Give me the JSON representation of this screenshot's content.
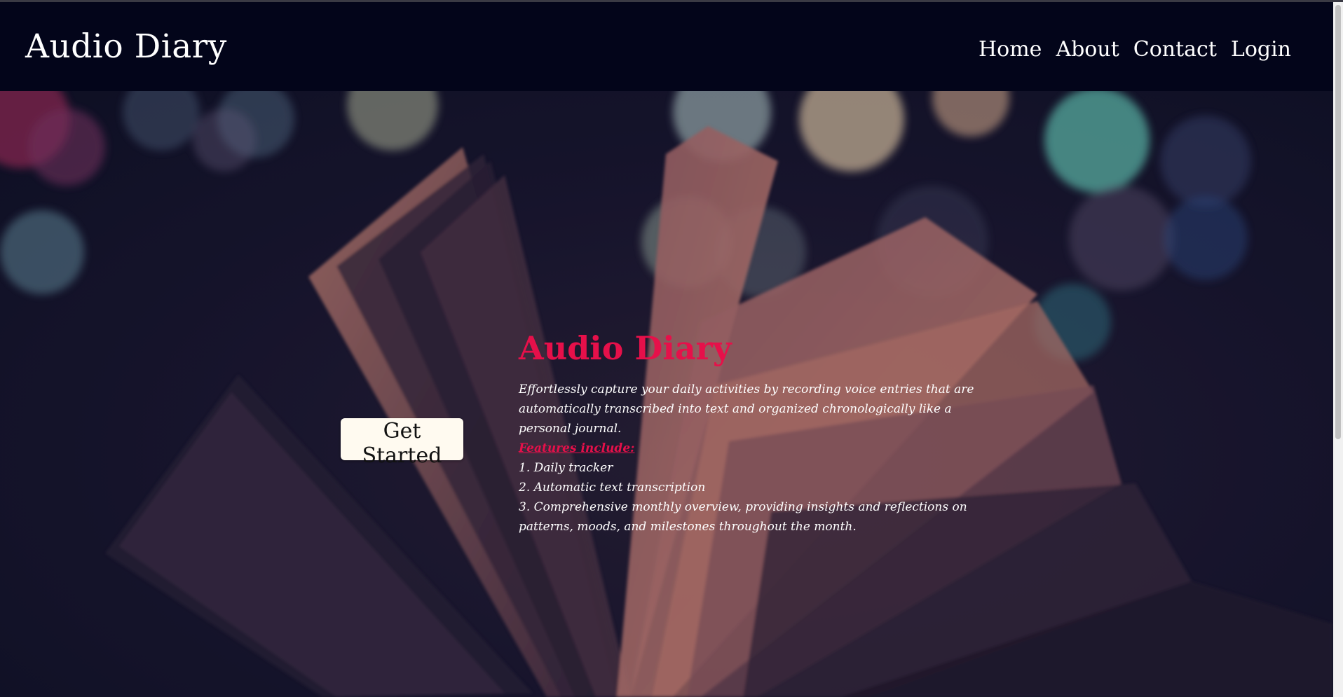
{
  "header": {
    "brand": "Audio Diary",
    "nav": [
      "Home",
      "About",
      "Contact",
      "Login"
    ]
  },
  "hero": {
    "cta_label": "Get Started",
    "title": "Audio Diary",
    "description": "Effortlessly capture your daily activities by recording voice entries that are automatically transcribed into text and organized chronologically like a personal journal.",
    "features_title": "Features include:",
    "features": [
      "1. Daily tracker",
      "2. Automatic text transcription",
      "3. Comprehensive monthly overview, providing insights and reflections on patterns, moods, and milestones throughout the month."
    ]
  },
  "colors": {
    "navbar_bg": "#03051a",
    "accent": "#e6104a",
    "button_bg": "#fffaf0"
  }
}
